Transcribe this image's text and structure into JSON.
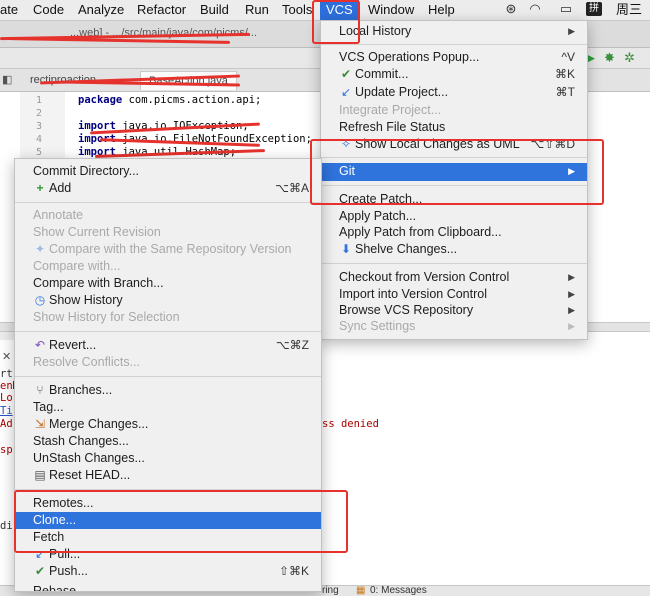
{
  "menubar": {
    "items": [
      "ate",
      "Code",
      "Analyze",
      "Refactor",
      "Build",
      "Run",
      "Tools",
      "VCS",
      "Window",
      "Help"
    ],
    "clock": "周三"
  },
  "titlebar": {
    "path": "...web] - .../src/main/java/com/picms/..."
  },
  "tabs": [
    "rectiproaction",
    "BaseAction.java"
  ],
  "editor": {
    "line_numbers": [
      "1",
      "2",
      "3",
      "4",
      "5"
    ],
    "lines": [
      {
        "kw": "package",
        "text": "com.picms.action.api;"
      },
      {
        "kw": "",
        "text": ""
      },
      {
        "kw": "import",
        "text": "java.io.IOException;"
      },
      {
        "kw": "import",
        "text": "java.io.FileNotFoundException;"
      },
      {
        "kw": "import",
        "text": "java.util.HashMap;"
      }
    ]
  },
  "console": {
    "left_frags": [
      "rt.",
      "enM",
      "Lo",
      "Ti",
      "Ad",
      "sp",
      "di"
    ],
    "error_tail": "ss denied"
  },
  "statusbar": {
    "left": "ring",
    "messages": "0: Messages"
  },
  "vcs_menu": {
    "local_history": "Local History",
    "items": [
      {
        "label": "VCS Operations Popup...",
        "shortcut": "^V"
      },
      {
        "label": "Commit...",
        "shortcut": "⌘K",
        "icon": "commit-icon"
      },
      {
        "label": "Update Project...",
        "shortcut": "⌘T",
        "icon": "update-icon"
      },
      {
        "label": "Integrate Project...",
        "disabled": true
      },
      {
        "label": "Refresh File Status"
      },
      {
        "label": "Show Local Changes as UML",
        "shortcut": "⌥⇧⌘D",
        "icon": "uml-icon"
      },
      {
        "label": "Git",
        "selected": true,
        "submenu": true
      },
      {
        "label": "Create Patch..."
      },
      {
        "label": "Apply Patch..."
      },
      {
        "label": "Apply Patch from Clipboard..."
      },
      {
        "label": "Shelve Changes...",
        "icon": "shelve-icon"
      },
      {
        "label": "Checkout from Version Control",
        "submenu": true
      },
      {
        "label": "Import into Version Control",
        "submenu": true
      },
      {
        "label": "Browse VCS Repository",
        "submenu": true
      },
      {
        "label": "Sync Settings",
        "submenu": true,
        "disabled": true
      }
    ]
  },
  "git_menu": {
    "items": [
      {
        "label": "Commit Directory..."
      },
      {
        "label": "Add",
        "shortcut": "⌥⌘A",
        "icon": "add-icon"
      },
      {
        "label": "Annotate",
        "disabled": true
      },
      {
        "label": "Show Current Revision",
        "disabled": true
      },
      {
        "label": "Compare with the Same Repository Version",
        "disabled": true,
        "icon": "compare-icon"
      },
      {
        "label": "Compare with...",
        "disabled": true
      },
      {
        "label": "Compare with Branch..."
      },
      {
        "label": "Show History",
        "icon": "history-icon"
      },
      {
        "label": "Show History for Selection",
        "disabled": true
      },
      {
        "label": "Revert...",
        "shortcut": "⌥⌘Z",
        "icon": "revert-icon"
      },
      {
        "label": "Resolve Conflicts...",
        "disabled": true
      },
      {
        "label": "Branches...",
        "icon": "branches-icon"
      },
      {
        "label": "Tag..."
      },
      {
        "label": "Merge Changes...",
        "icon": "merge-icon"
      },
      {
        "label": "Stash Changes..."
      },
      {
        "label": "UnStash Changes..."
      },
      {
        "label": "Reset HEAD...",
        "icon": "reset-icon"
      },
      {
        "label": "Remotes..."
      },
      {
        "label": "Clone...",
        "selected": true
      },
      {
        "label": "Fetch"
      },
      {
        "label": "Pull...",
        "icon": "pull-icon"
      },
      {
        "label": "Push...",
        "shortcut": "⇧⌘K",
        "icon": "push-icon"
      },
      {
        "label": "Rebase..."
      }
    ]
  },
  "colors": {
    "selection": "#2f73dc",
    "annotation_red": "#e5322d",
    "menu_bg": "#f0f0f0"
  }
}
